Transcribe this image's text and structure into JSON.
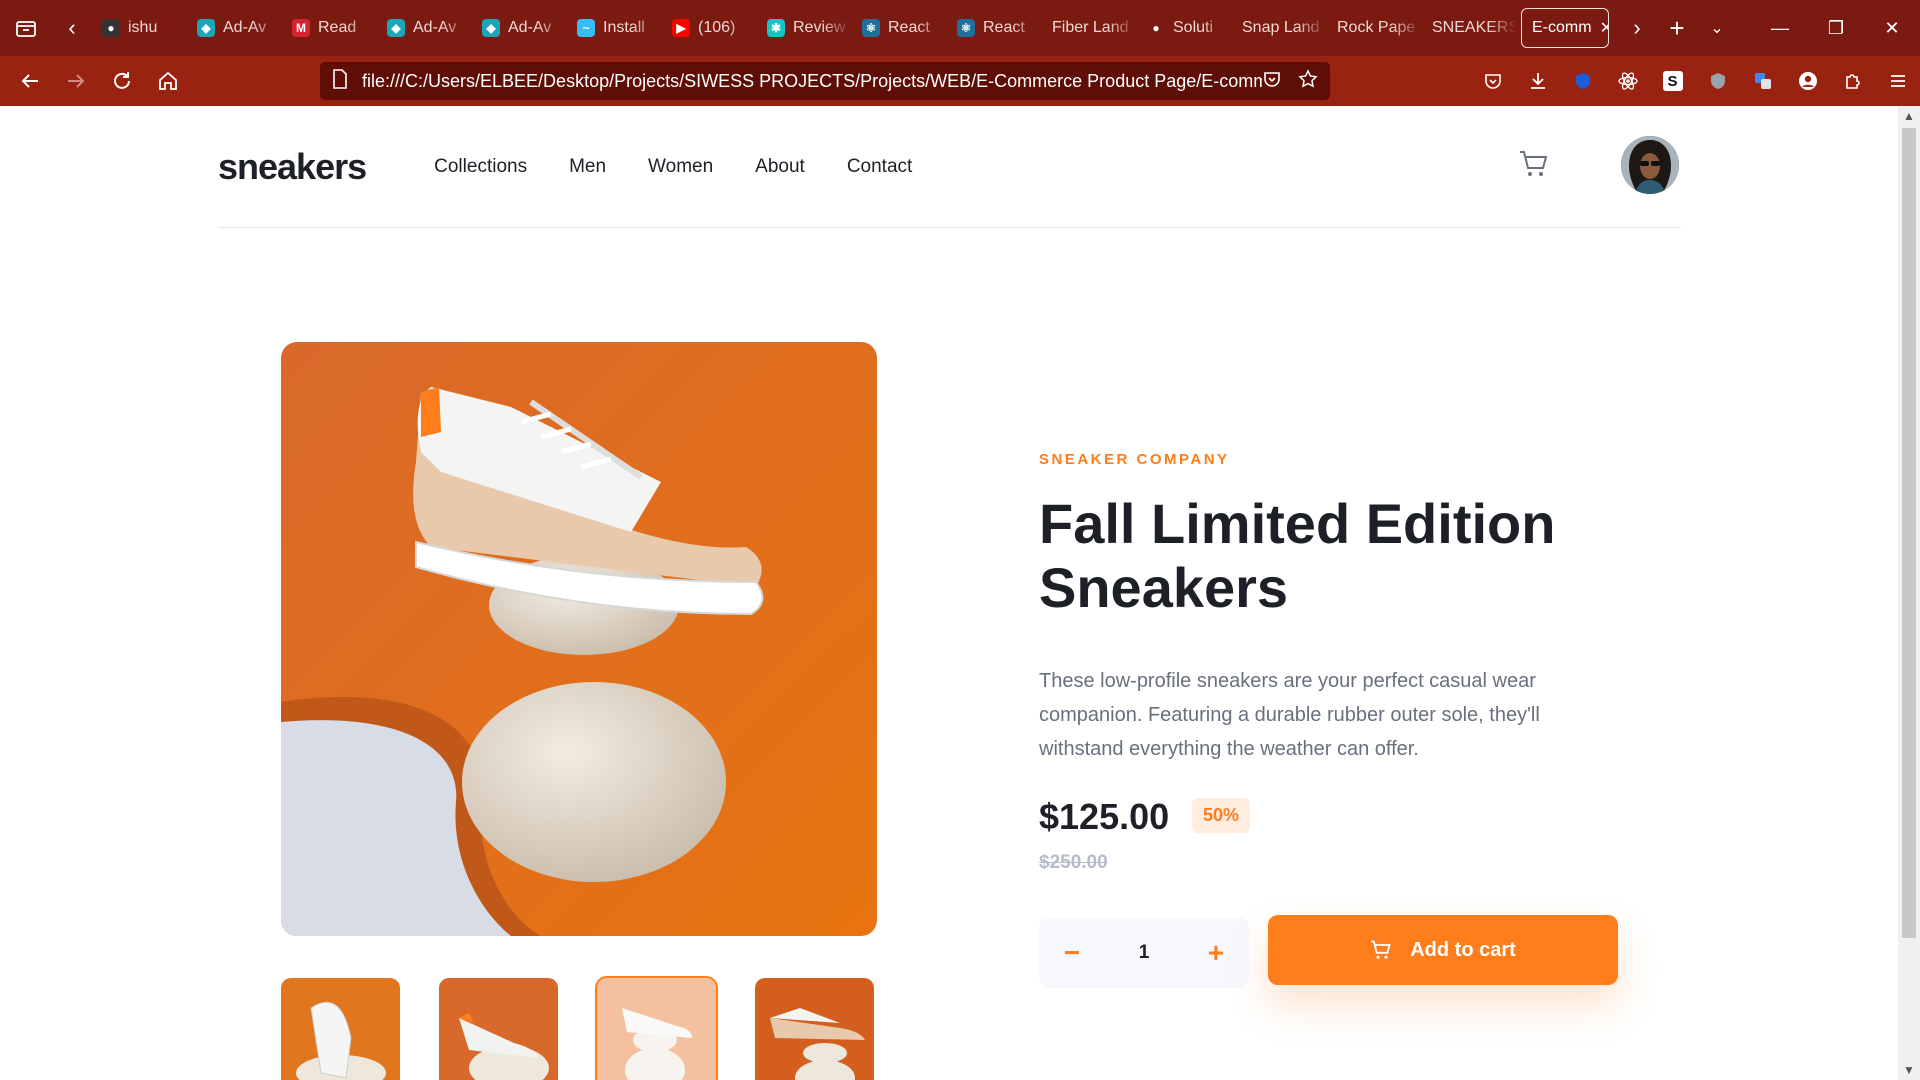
{
  "browser": {
    "tabs": [
      {
        "label": "ishu",
        "icon": "github-icon"
      },
      {
        "label": "Ad-Av",
        "icon": "shield-icon"
      },
      {
        "label": "Read",
        "icon": "m-logo-icon"
      },
      {
        "label": "Ad-Av",
        "icon": "shield-icon"
      },
      {
        "label": "Ad-Av",
        "icon": "shield-icon"
      },
      {
        "label": "Install",
        "icon": "wave-icon"
      },
      {
        "label": "(106)",
        "icon": "youtube-icon"
      },
      {
        "label": "Review",
        "icon": "puzzle-icon"
      },
      {
        "label": "React",
        "icon": "react-icon"
      },
      {
        "label": "React",
        "icon": "react-icon"
      },
      {
        "label": "Fiber Land",
        "icon": ""
      },
      {
        "label": "Soluti",
        "icon": "circle-icon"
      },
      {
        "label": "Snap Land",
        "icon": ""
      },
      {
        "label": "Rock Pape",
        "icon": ""
      },
      {
        "label": "SNEAKERS",
        "icon": ""
      }
    ],
    "active_tab": "E-comm",
    "url": "file:///C:/Users/ELBEE/Desktop/Projects/SIWESS PROJECTS/Projects/WEB/E-Commerce Product Page/E-commerce_pro"
  },
  "site": {
    "logo": "sneakers",
    "menu": [
      "Collections",
      "Men",
      "Women",
      "About",
      "Contact"
    ]
  },
  "product": {
    "company": "SNEAKER COMPANY",
    "title": "Fall Limited Edition Sneakers",
    "description": "These low-profile sneakers are your perfect casual wear companion. Featuring a durable rubber outer sole, they'll withstand everything the weather can offer.",
    "price": "$125.00",
    "discount": "50%",
    "old_price": "$250.00",
    "quantity": "1",
    "minus": "−",
    "plus": "+",
    "add_to_cart": "Add to cart",
    "thumbnails_selected": 3
  },
  "colors": {
    "accent": "#ff7d1a",
    "chrome_dark": "#7a1a10",
    "chrome_nav": "#9a2210",
    "text_dark": "#1d2026"
  }
}
